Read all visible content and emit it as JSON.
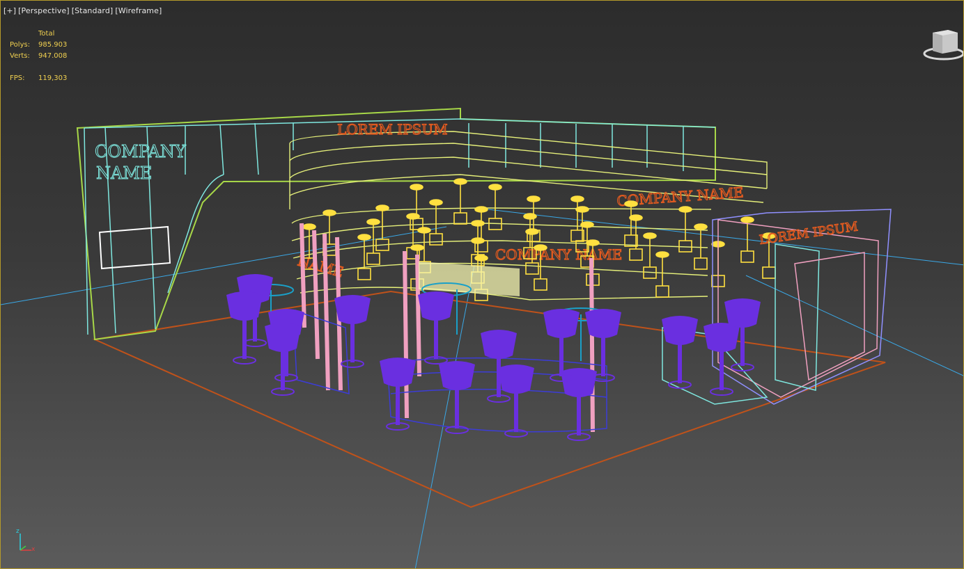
{
  "viewport": {
    "labels": [
      "[+]",
      "[Perspective]",
      "[Standard]",
      "[Wireframe]"
    ]
  },
  "stats": {
    "total_label": "Total",
    "polys_label": "Polys:",
    "polys_value": "985.903",
    "verts_label": "Verts:",
    "verts_value": "947.008",
    "fps_label": "FPS:",
    "fps_value": "119,303"
  },
  "scene": {
    "wall_text_line1": "COMPANY",
    "wall_text_line2": "NAME",
    "top_banner": "LOREM IPSUM",
    "bar_sign_right": "COMPANY NAME",
    "bar_sign_front": "COMPANY NAME",
    "bar_sign_left": "NAME",
    "booth_sign": "LOREM IPSUM",
    "colors": {
      "wall": "#7fe8e0",
      "wall_lime": "#a8d848",
      "bar_yellow": "#e6f07a",
      "lamp": "#ffe040",
      "text": "#e05a20",
      "chairs": "#6a2fe0",
      "pillars": "#f0a0c0",
      "floor": "#c0521a",
      "grid": "#3aa9e8",
      "counter": "#3c3cd8"
    }
  },
  "viewcube": {
    "icon": "viewcube-icon"
  },
  "axis_tripod": {
    "icon": "axis-tripod-icon",
    "z_label": "z",
    "x_label": "x"
  }
}
